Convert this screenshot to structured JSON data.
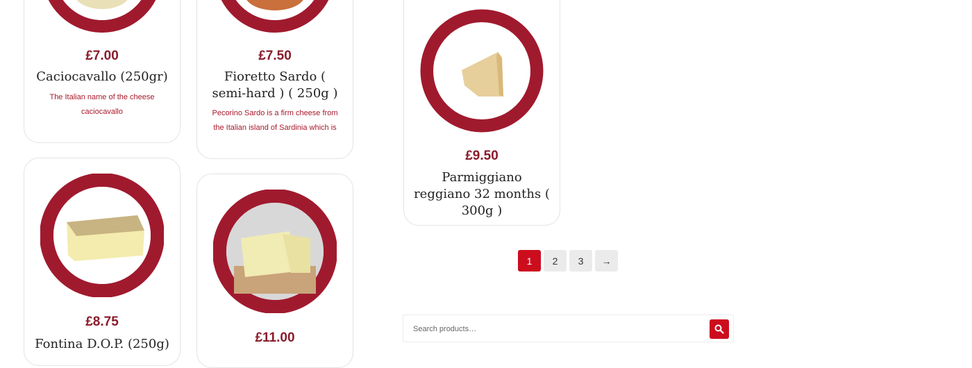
{
  "products": [
    {
      "price": "£7.00",
      "title": "Caciocavallo (250gr)",
      "description": "The Italian name of the cheese caciocavallo"
    },
    {
      "price": "£7.50",
      "title": "Fioretto Sardo ( semi-hard ) ( 250g )",
      "description": "Pecorino Sardo is a firm cheese from the Italian island of Sardinia which is"
    },
    {
      "price": "£9.50",
      "title": "Parmiggiano reggiano 32 months ( 300g )",
      "description": ""
    },
    {
      "price": "£8.75",
      "title": "Fontina D.O.P. (250g)",
      "description": ""
    },
    {
      "price": "£11.00",
      "title": "",
      "description": ""
    }
  ],
  "pagination": {
    "pages": [
      "1",
      "2",
      "3"
    ],
    "next": "→",
    "current": "1"
  },
  "search": {
    "placeholder": "Search products…"
  },
  "colors": {
    "accent": "#cc0d1e",
    "ring": "#a01a2e",
    "price": "#8a1c2b"
  },
  "icons": {
    "search": "search-icon"
  }
}
